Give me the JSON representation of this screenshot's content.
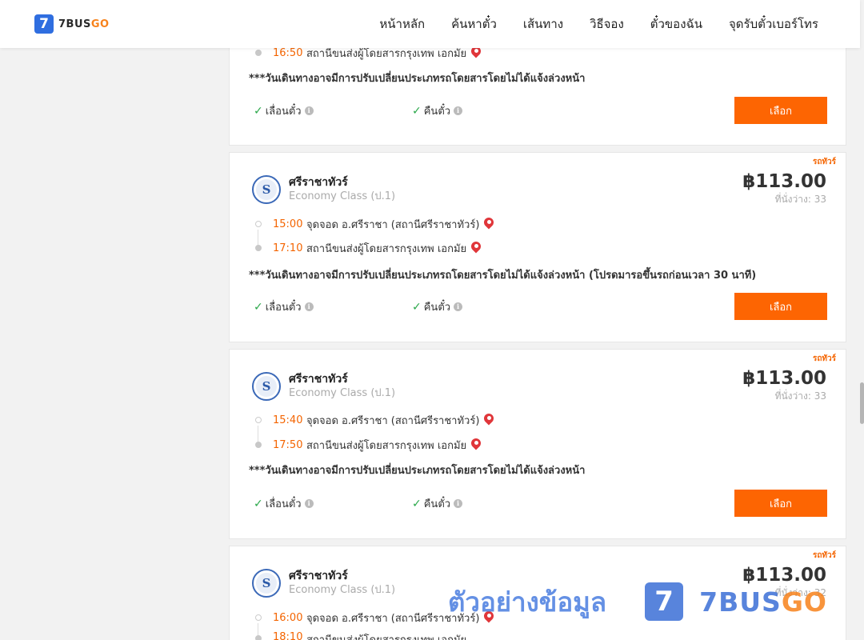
{
  "header": {
    "logo_number": "7",
    "logo_text_main": "7BUS",
    "logo_text_go": "GO",
    "nav": [
      "หน้าหลัก",
      "ค้นหาตั๋ว",
      "เส้นทาง",
      "วิธีจอง",
      "ตั๋วของฉัน",
      "จุดรับตั๋วเบอร์โทร"
    ]
  },
  "partial_card": {
    "arrival_time": "16:50",
    "arrival_station": "สถานีขนส่งผู้โดยสารกรุงเทพ เอกมัย",
    "note": "***วันเดินทางอาจมีการปรับเปลี่ยนประเภทรถโดยสารโดยไม่ได้แจ้งล่วงหน้า",
    "policy_change": "เลื่อนตั๋ว",
    "policy_refund": "คืนตั๋ว",
    "select_label": "เลือก"
  },
  "cards": [
    {
      "tag": "รถทัวร์",
      "operator": "ศรีราชาทัวร์",
      "class": "Economy Class (ป.1)",
      "price": "฿113.00",
      "seats": "ที่นั่งว่าง: 33",
      "dep_time": "15:00",
      "dep_station": "จุดจอด อ.ศรีราชา (สถานีศรีราชาทัวร์)",
      "arr_time": "17:10",
      "arr_station": "สถานีขนส่งผู้โดยสารกรุงเทพ เอกมัย",
      "note": "***วันเดินทางอาจมีการปรับเปลี่ยนประเภทรถโดยสารโดยไม่ได้แจ้งล่วงหน้า (โปรดมารอขึ้นรถก่อนเวลา 30 นาที)",
      "policy_change": "เลื่อนตั๋ว",
      "policy_refund": "คืนตั๋ว",
      "select_label": "เลือก"
    },
    {
      "tag": "รถทัวร์",
      "operator": "ศรีราชาทัวร์",
      "class": "Economy Class (ป.1)",
      "price": "฿113.00",
      "seats": "ที่นั่งว่าง: 33",
      "dep_time": "15:40",
      "dep_station": "จุดจอด อ.ศรีราชา (สถานีศรีราชาทัวร์)",
      "arr_time": "17:50",
      "arr_station": "สถานีขนส่งผู้โดยสารกรุงเทพ เอกมัย",
      "note": "***วันเดินทางอาจมีการปรับเปลี่ยนประเภทรถโดยสารโดยไม่ได้แจ้งล่วงหน้า",
      "policy_change": "เลื่อนตั๋ว",
      "policy_refund": "คืนตั๋ว",
      "select_label": "เลือก"
    },
    {
      "tag": "รถทัวร์",
      "operator": "ศรีราชาทัวร์",
      "class": "Economy Class (ป.1)",
      "price": "฿113.00",
      "seats": "ที่นั่งว่าง: 32",
      "dep_time": "16:00",
      "dep_station": "จุดจอด อ.ศรีราชา (สถานีศรีราชาทัวร์)",
      "arr_time": "18:10",
      "arr_station": "สถานีขนส่งผู้โดยสารกรุงเทพ เอกมัย"
    }
  ],
  "watermark": {
    "text": "ตัวอย่างข้อมูล",
    "logo_number": "7",
    "brand_main": "7BUS",
    "brand_go": "GO"
  }
}
